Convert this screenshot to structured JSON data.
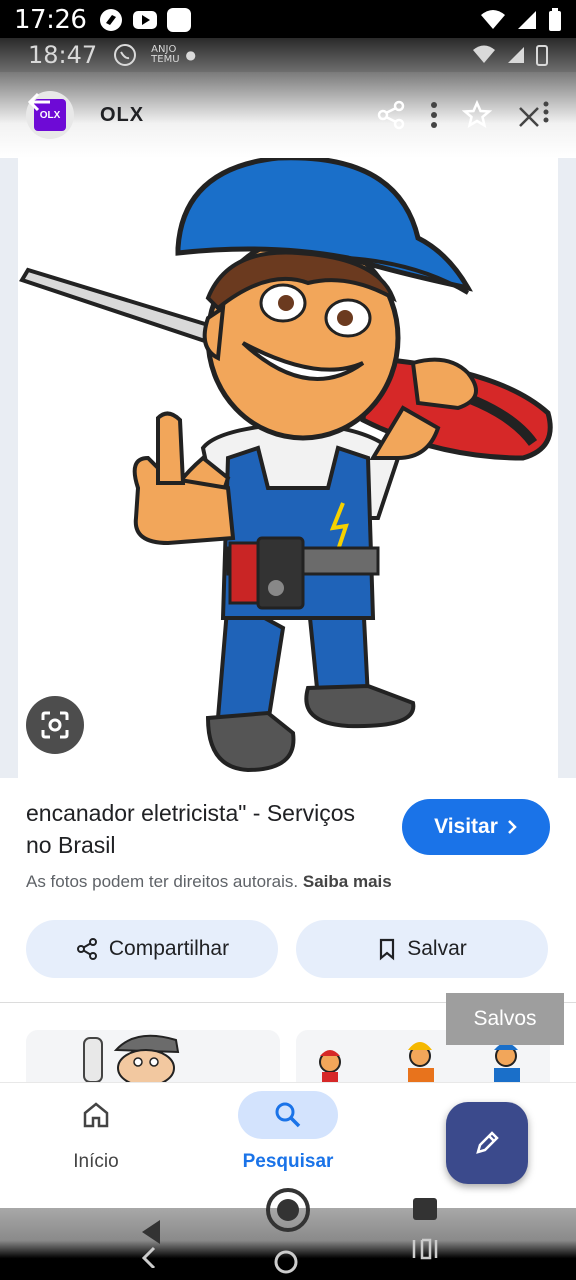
{
  "status_bar": {
    "time": "17:26",
    "ghost_time": "18:47",
    "ghost_small_1": "ANJO",
    "ghost_small_2": "TEMU"
  },
  "header": {
    "site_name": "OLX",
    "favicon_text": "OLX",
    "back_icon": "back-arrow-icon",
    "tools": [
      "share-icon",
      "more-vert-icon",
      "star-icon",
      "close-icon"
    ]
  },
  "image": {
    "alt_icon": "lens-icon"
  },
  "result": {
    "title": "encanador eletricista\" - Serviços no Brasil",
    "visit_label": "Visitar",
    "rights_text": "As fotos podem ter direitos autorais.",
    "rights_link": "Saiba mais"
  },
  "actions": {
    "share_label": "Compartilhar",
    "save_label": "Salvar"
  },
  "toast": {
    "saved_label": "Salvos"
  },
  "bottom_nav": {
    "home_label": "Início",
    "search_label": "Pesquisar"
  },
  "colors": {
    "accent": "#1a73e8",
    "pill_bg": "#e6eefb",
    "fab_bg": "#3b4a8c"
  }
}
